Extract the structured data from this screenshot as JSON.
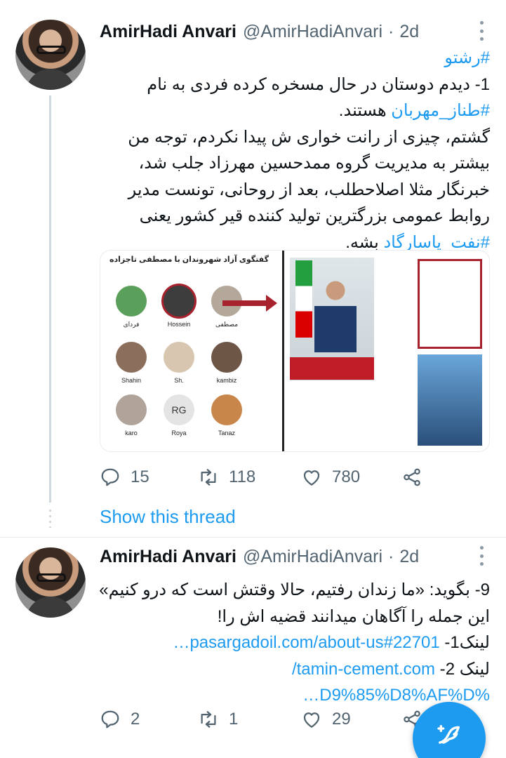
{
  "tweets": [
    {
      "author_name": "AmirHadi Anvari",
      "handle": "@AmirHadiAnvari",
      "separator": "·",
      "time": "2d",
      "lines": [
        {
          "parts": [
            {
              "text": "#رشتو",
              "link": true
            }
          ]
        },
        {
          "parts": [
            {
              "text": "1- دیدم دوستان در حال مسخره کرده فردی به نام",
              "link": false
            }
          ]
        },
        {
          "parts": [
            {
              "text": "#طناز_مهربان",
              "link": true
            },
            {
              "text": " هستند.",
              "link": false
            }
          ]
        },
        {
          "parts": [
            {
              "text": "گشتم، چیزی از رانت خواری ش پیدا نکردم، توجه من",
              "link": false
            }
          ]
        },
        {
          "parts": [
            {
              "text": "بیشتر به مدیریت گروه ممدحسین مهرزاد جلب شد،",
              "link": false
            }
          ]
        },
        {
          "parts": [
            {
              "text": "خبرنگار مثلا اصلاحطلب، بعد از روحانی، تونست مدیر",
              "link": false
            }
          ]
        },
        {
          "parts": [
            {
              "text": "روابط عمومی بزرگترین تولید کننده قیر کشور یعنی",
              "link": false
            }
          ]
        },
        {
          "parts": [
            {
              "text": "#نفت_پاسارگاد",
              "link": true
            },
            {
              "text": " بشه.",
              "link": false
            }
          ]
        }
      ],
      "media": {
        "title": "گفتگوی آزاد شهروندان با مصطفی تاجزاده",
        "speakers": [
          "مصطفی",
          "Hossein",
          "فردای",
          "kambiz",
          "Sh.",
          "Shahin",
          "Tanaz",
          "Roya",
          "karo"
        ],
        "roya_initials": "RG"
      },
      "counts": {
        "replies": "15",
        "retweets": "118",
        "likes": "780"
      },
      "show_thread": "Show this thread"
    },
    {
      "author_name": "AmirHadi Anvari",
      "handle": "@AmirHadiAnvari",
      "separator": "·",
      "time": "2d",
      "lines": [
        {
          "parts": [
            {
              "text": "9- بگوید: «ما زندان رفتیم، حالا وقتش است که درو کنیم»",
              "link": false
            }
          ]
        },
        {
          "parts": [
            {
              "text": "این جمله را آگاهان میدانند قضیه اش را!",
              "link": false
            }
          ]
        },
        {
          "parts": [
            {
              "text": "لینک1- ",
              "link": false
            },
            {
              "text": "pasargadoil.com/about-us#22701…",
              "link": true
            }
          ]
        },
        {
          "parts": [
            {
              "text": "لینک 2- ",
              "link": false
            },
            {
              "text": "tamin-cement.com/",
              "link": true
            }
          ]
        },
        {
          "parts": [
            {
              "text": "%D9%85%D8%AF%D…",
              "link": true
            }
          ]
        }
      ],
      "counts": {
        "replies": "2",
        "retweets": "1",
        "likes": "29"
      }
    }
  ],
  "icons": {
    "reply": "reply-icon",
    "retweet": "retweet-icon",
    "like": "heart-icon",
    "share": "share-icon",
    "more": "more-dots-icon",
    "compose": "compose-tweet-icon"
  },
  "colors": {
    "link": "#1d9bf0",
    "muted": "#536471",
    "fab": "#1d9bf0"
  }
}
